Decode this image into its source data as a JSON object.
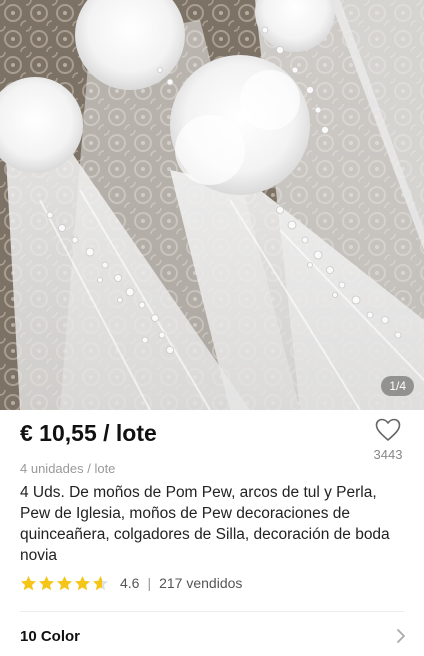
{
  "gallery": {
    "image_counter": "1/4",
    "image_alt": "Lazos de tul blanco con perlas para bancos de iglesia"
  },
  "product": {
    "price": "€ 10,55 / lote",
    "unit_note": "4 unidades / lote",
    "title": "4 Uds. De moños de Pom Pew, arcos de tul y Perla, Pew de Iglesia, moños de Pew decoraciones de quinceañera, colgadores de Silla, decoración de boda novia",
    "wishlist_count": "3443",
    "rating": "4.6",
    "rating_stars": 4.6,
    "sold": "217 vendidos"
  },
  "variant": {
    "label": "10 Color"
  },
  "colors": {
    "star": "#f5c518",
    "star_empty": "#e0e0e0",
    "price": "#111111",
    "muted": "#999999"
  },
  "icons": {
    "wishlist": "heart-outline-icon",
    "variant_chevron": "chevron-right-icon"
  }
}
